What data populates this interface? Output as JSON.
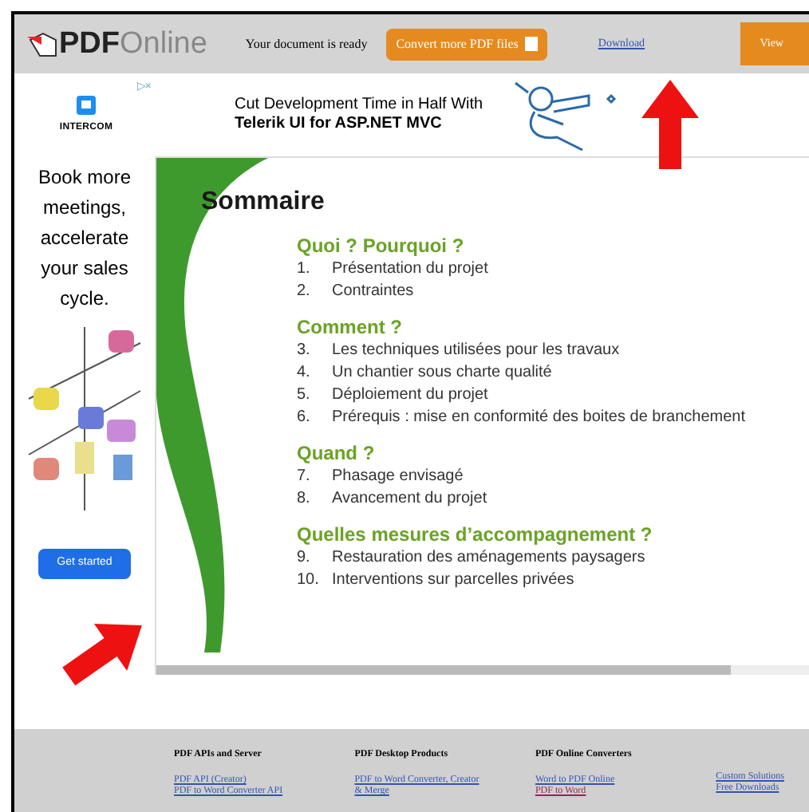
{
  "header": {
    "logo_bold": "PDF",
    "logo_light": "Online",
    "status": "Your document is ready",
    "convert_button": "Convert more PDF files",
    "download_link": "Download",
    "view_button": "View"
  },
  "banner_ad": {
    "badge": "▷×",
    "line_1": "Cut Development Time in Half With",
    "line_2": "Telerik UI for ASP.NET MVC"
  },
  "side_ad": {
    "brand": "INTERCOM",
    "text": "Book more meetings, accelerate your sales cycle.",
    "button": "Get started"
  },
  "document": {
    "title": "Sommaire",
    "sections": [
      {
        "heading": "Quoi ? Pourquoi ?",
        "items": [
          {
            "number": "1.",
            "text": "Présentation du projet"
          },
          {
            "number": "2.",
            "text": "Contraintes"
          }
        ]
      },
      {
        "heading": "Comment ?",
        "items": [
          {
            "number": "3.",
            "text": "Les techniques utilisées pour les travaux"
          },
          {
            "number": "4.",
            "text": "Un chantier sous charte qualité"
          },
          {
            "number": "5.",
            "text": "Déploiement du projet"
          },
          {
            "number": "6.",
            "text": "Prérequis : mise en conformité des boites de branchement"
          }
        ]
      },
      {
        "heading": "Quand ?",
        "items": [
          {
            "number": "7.",
            "text": "Phasage envisagé"
          },
          {
            "number": "8.",
            "text": "Avancement du projet"
          }
        ]
      },
      {
        "heading": "Quelles mesures d’accompagnement ?",
        "items": [
          {
            "number": "9.",
            "text": "Restauration des aménagements paysagers"
          },
          {
            "number": "10.",
            "text": "Interventions sur parcelles privées"
          }
        ]
      }
    ]
  },
  "footer": {
    "columns": [
      {
        "heading": "PDF APIs and Server",
        "links": [
          "PDF API (Creator)",
          "PDF to Word Converter API"
        ]
      },
      {
        "heading": "PDF Desktop Products",
        "links": [
          "PDF to Word Converter, Creator",
          "& Merge"
        ]
      },
      {
        "heading": "PDF Online Converters",
        "links": [
          "Word to PDF Online",
          "PDF to Word"
        ]
      },
      {
        "links": [
          "Custom Solutions",
          "Free Downloads"
        ]
      }
    ]
  }
}
